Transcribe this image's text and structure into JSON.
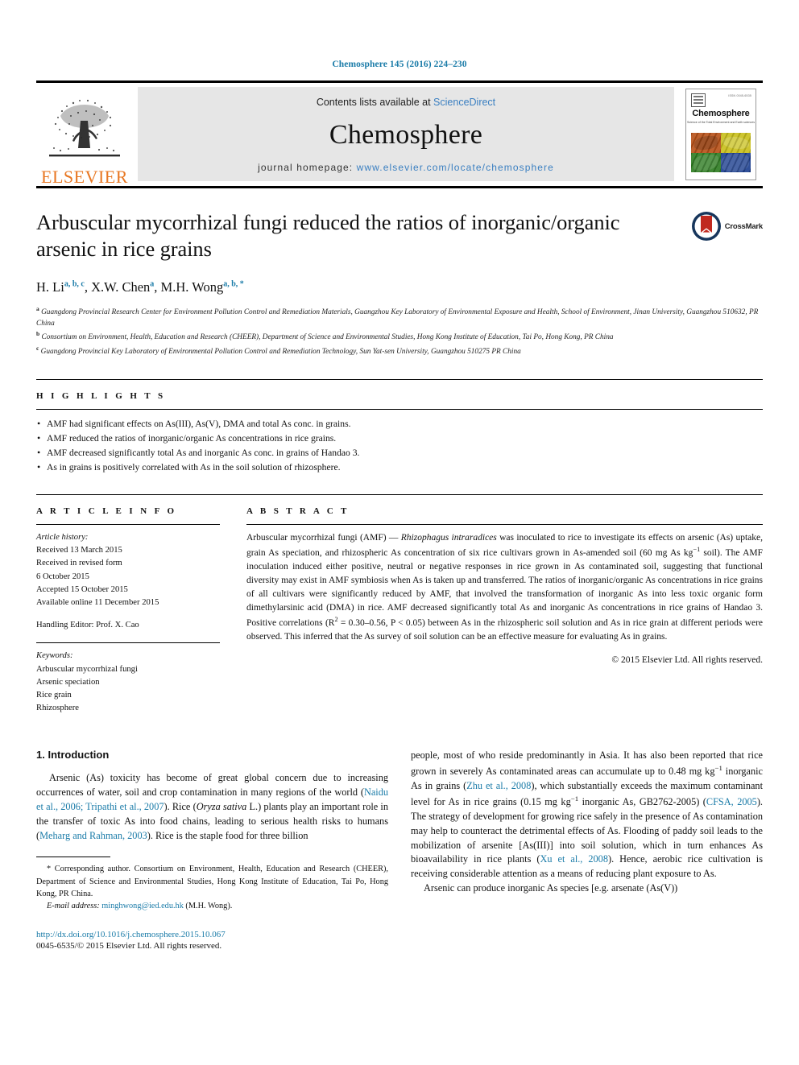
{
  "running_head": "Chemosphere 145 (2016) 224–230",
  "masthead": {
    "publisher_name": "ELSEVIER",
    "contents_prefix": "Contents lists available at ",
    "contents_link": "ScienceDirect",
    "journal_name": "Chemosphere",
    "homepage_prefix": "journal homepage: ",
    "homepage_url": "www.elsevier.com/locate/chemosphere",
    "cover": {
      "title": "Chemosphere",
      "subtitle": "Science of the Total Environment and Earth sciences",
      "issn": "ISSN 0045-6535"
    }
  },
  "article": {
    "title": "Arbuscular mycorrhizal fungi reduced the ratios of inorganic/organic arsenic in rice grains",
    "crossmark_label": "CrossMark",
    "authors": [
      {
        "name": "H. Li",
        "sup": "a, b, c"
      },
      {
        "name": "X.W. Chen",
        "sup": "a"
      },
      {
        "name": "M.H. Wong",
        "sup": "a, b, *"
      }
    ],
    "affiliations": [
      {
        "marker": "a",
        "text": "Guangdong Provincial Research Center for Environment Pollution Control and Remediation Materials, Guangzhou Key Laboratory of Environmental Exposure and Health, School of Environment, Jinan University, Guangzhou 510632, PR China"
      },
      {
        "marker": "b",
        "text": "Consortium on Environment, Health, Education and Research (CHEER), Department of Science and Environmental Studies, Hong Kong Institute of Education, Tai Po, Hong Kong, PR China"
      },
      {
        "marker": "c",
        "text": "Guangdong Provincial Key Laboratory of Environmental Pollution Control and Remediation Technology, Sun Yat-sen University, Guangzhou 510275 PR China"
      }
    ]
  },
  "highlights": {
    "heading": "H I G H L I G H T S",
    "items": [
      "AMF had significant effects on As(III), As(V), DMA and total As conc. in grains.",
      "AMF reduced the ratios of inorganic/organic As concentrations in rice grains.",
      "AMF decreased significantly total As and inorganic As conc. in grains of Handao 3.",
      "As in grains is positively correlated with As in the soil solution of rhizosphere."
    ]
  },
  "article_info": {
    "heading": "A R T I C L E   I N F O",
    "history_label": "Article history:",
    "history": [
      "Received 13 March 2015",
      "Received in revised form",
      "6 October 2015",
      "Accepted 15 October 2015",
      "Available online 11 December 2015"
    ],
    "handling_editor": "Handling Editor: Prof. X. Cao",
    "keywords_label": "Keywords:",
    "keywords": [
      "Arbuscular mycorrhizal fungi",
      "Arsenic speciation",
      "Rice grain",
      "Rhizosphere"
    ]
  },
  "abstract": {
    "heading": "A B S T R A C T",
    "part1": "Arbuscular mycorrhizal fungi (AMF) — ",
    "species": "Rhizophagus intraradices",
    "part2": " was inoculated to rice to investigate its effects on arsenic (As) uptake, grain As speciation, and rhizospheric As concentration of six rice cultivars grown in As-amended soil (60 mg As kg",
    "sup1": "−1",
    "part3": " soil). The AMF inoculation induced either positive, neutral or negative responses in rice grown in As contaminated soil, suggesting that functional diversity may exist in AMF symbiosis when As is taken up and transferred. The ratios of inorganic/organic As concentrations in rice grains of all cultivars were significantly reduced by AMF, that involved the transformation of inorganic As into less toxic organic form dimethylarsinic acid (DMA) in rice. AMF decreased significantly total As and inorganic As concentrations in rice grains of Handao 3. Positive correlations (R",
    "sup2": "2",
    "part4": " = 0.30–0.56, P < 0.05) between As in the rhizospheric soil solution and As in rice grain at different periods were observed. This inferred that the As survey of soil solution can be an effective measure for evaluating As in grains.",
    "copyright": "© 2015 Elsevier Ltd. All rights reserved."
  },
  "introduction": {
    "heading": "1. Introduction",
    "left_p1_a": "Arsenic (As) toxicity has become of great global concern due to increasing occurrences of water, soil and crop contamination in many regions of the world (",
    "left_cit1": "Naidu et al., 2006; Tripathi et al., 2007",
    "left_p1_b": "). Rice (",
    "left_italic1": "Oryza sativa",
    "left_p1_c": " L.) plants play an important role in the transfer of toxic As into food chains, leading to serious health risks to humans (",
    "left_cit2": "Meharg and Rahman, 2003",
    "left_p1_d": "). Rice is the staple food for three billion",
    "right_p1_a": "people, most of who reside predominantly in Asia. It has also been reported that rice grown in severely As contaminated areas can accumulate up to 0.48 mg kg",
    "right_sup1": "−1",
    "right_p1_b": " inorganic As in grains (",
    "right_cit1": "Zhu et al., 2008",
    "right_p1_c": "), which substantially exceeds the maximum contaminant level for As in rice grains (0.15 mg kg",
    "right_sup2": "−1",
    "right_p1_d": " inorganic As, GB2762-2005) (",
    "right_cit2": "CFSA, 2005",
    "right_p1_e": "). The strategy of development for growing rice safely in the presence of As contamination may help to counteract the detrimental effects of As. Flooding of paddy soil leads to the mobilization of arsenite [As(III)] into soil solution, which in turn enhances As bioavailability in rice plants (",
    "right_cit3": "Xu et al., 2008",
    "right_p1_f": "). Hence, aerobic rice cultivation is receiving considerable attention as a means of reducing plant exposure to As.",
    "right_p2": "Arsenic can produce inorganic As species [e.g. arsenate (As(V))"
  },
  "footnotes": {
    "corresponding": "* Corresponding author. Consortium on Environment, Health, Education and Research (CHEER), Department of Science and Environmental Studies, Hong Kong Institute of Education, Tai Po, Hong Kong, PR China.",
    "email_label": "E-mail address:",
    "email": "minghwong@ied.edu.hk",
    "email_owner": "(M.H. Wong).",
    "doi": "http://dx.doi.org/10.1016/j.chemosphere.2015.10.067",
    "issn_line": "0045-6535/© 2015 Elsevier Ltd. All rights reserved."
  },
  "colors": {
    "link_blue": "#1a7ba8",
    "elsevier_orange": "#E87722",
    "band_gray": "#e6e6e6"
  }
}
